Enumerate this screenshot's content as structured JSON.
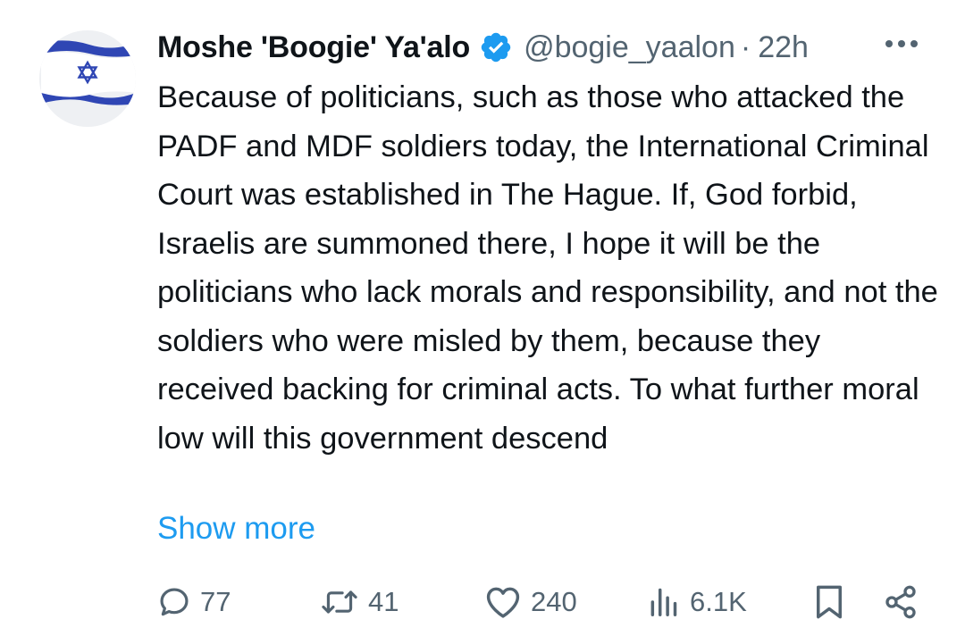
{
  "tweet": {
    "author_name": "Moshe 'Boogie' Ya'alo",
    "handle": "@bogie_yaalon",
    "separator": "·",
    "time": "22h",
    "avatar": {
      "icon": "israel-flag-icon",
      "stripe_color": "#2f46b4"
    },
    "verified_color": "#1d9bf0",
    "more_icon": "ellipsis-icon",
    "text": "Because of politicians, such as those who attacked the PADF and MDF soldiers today, the International Criminal Court was established in The Hague. If, God forbid, Israelis are summoned there, I hope it will be the politicians who lack morals and responsibility, and not the soldiers who were misled by them, because they received backing for criminal acts. To what further moral low will this government descend",
    "show_more": "Show more"
  },
  "actions": {
    "replies": {
      "icon": "reply-icon",
      "count": "77"
    },
    "reposts": {
      "icon": "repost-icon",
      "count": "41"
    },
    "likes": {
      "icon": "heart-icon",
      "count": "240"
    },
    "views": {
      "icon": "views-icon",
      "count": "6.1K"
    },
    "bookmark": {
      "icon": "bookmark-icon"
    },
    "share": {
      "icon": "share-icon"
    }
  },
  "colors": {
    "text": "#0f1419",
    "secondary": "#536471",
    "link": "#1d9bf0"
  }
}
